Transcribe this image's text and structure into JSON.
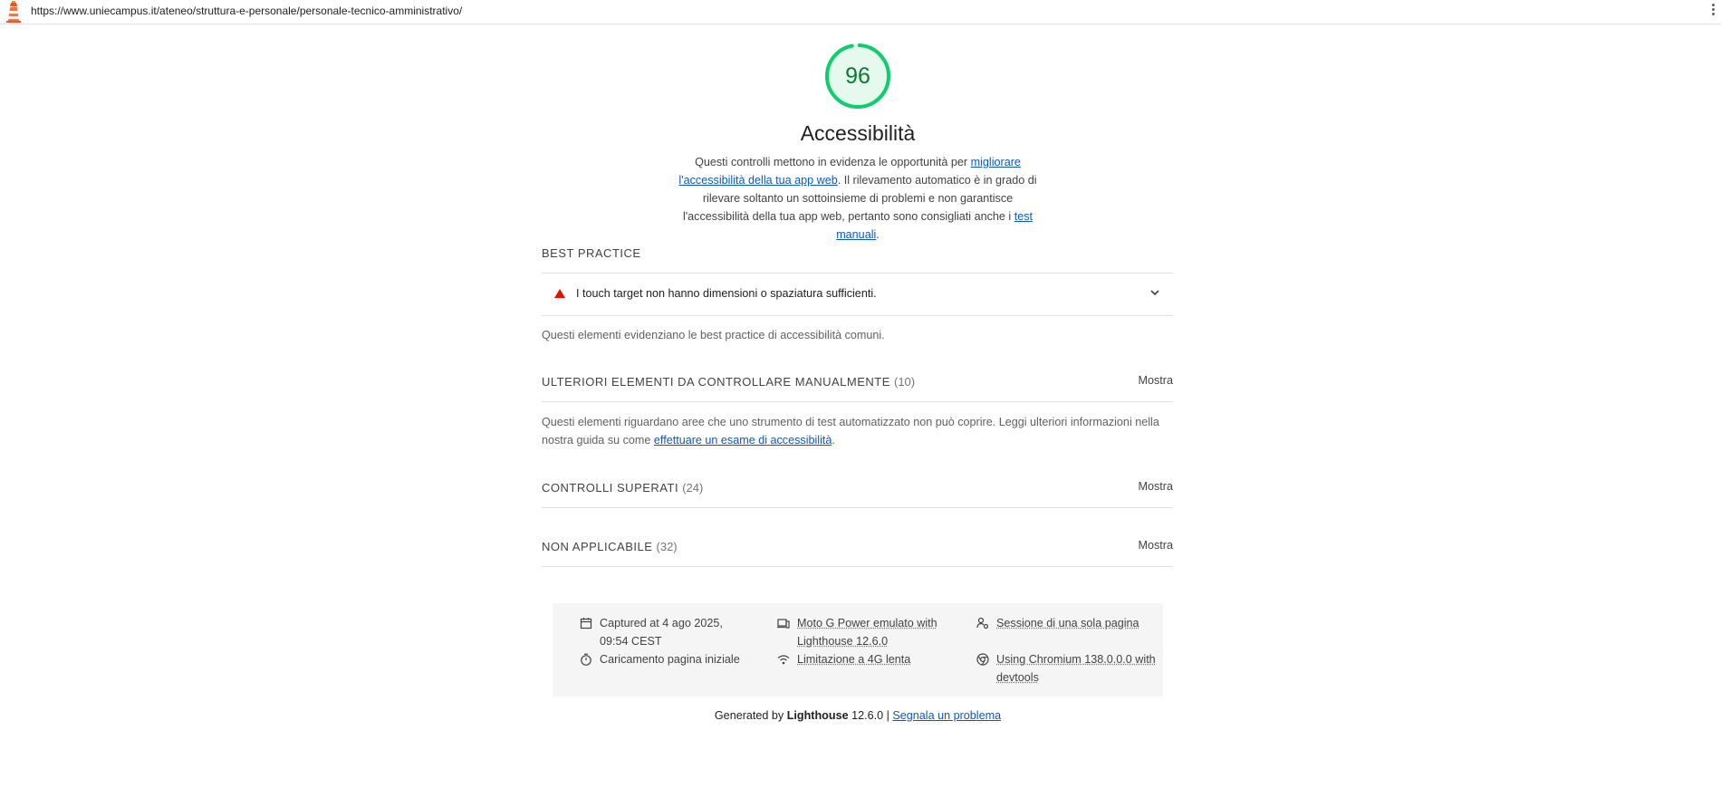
{
  "browser": {
    "url": "https://www.uniecampus.it/ateneo/struttura-e-personale/personale-tecnico-amministrativo/"
  },
  "category": {
    "score": "96",
    "score_fraction": 0.96,
    "title": "Accessibilità",
    "desc_part1": "Questi controlli mettono in evidenza le opportunità per ",
    "desc_link1": "migliorare l'accessibilità della tua app web",
    "desc_part2": ". Il rilevamento automatico è in grado di rilevare soltanto un sottoinsieme di problemi e non garantisce l'accessibilità della tua app web, pertanto sono consigliati anche i ",
    "desc_link2": "test manuali",
    "desc_part3": "."
  },
  "best_practice": {
    "heading": "Best practice",
    "audit_title": "I touch target non hanno dimensioni o spaziatura sufficienti.",
    "description": "Questi elementi evidenziano le best practice di accessibilità comuni."
  },
  "manual": {
    "heading": "Ulteriori elementi da controllare manualmente",
    "count": "(10)",
    "toggle": "Mostra",
    "desc_part1": "Questi elementi riguardano aree che uno strumento di test automatizzato non può coprire. Leggi ulteriori informazioni nella nostra guida su come ",
    "desc_link": "effettuare un esame di accessibilità",
    "desc_part2": "."
  },
  "passed": {
    "heading": "Controlli superati",
    "count": "(24)",
    "toggle": "Mostra"
  },
  "not_applicable": {
    "heading": "Non applicabile",
    "count": "(32)",
    "toggle": "Mostra"
  },
  "environment": {
    "captured": "Captured at 4 ago 2025, 09:54 CEST",
    "load": "Caricamento pagina iniziale",
    "device": "Moto G Power emulato with Lighthouse 12.6.0",
    "throttling": "Limitazione a 4G lenta",
    "session": "Sessione di una sola pagina",
    "browser": "Using Chromium 138.0.0.0 with devtools"
  },
  "footer": {
    "generated_by": "Generated by",
    "product": "Lighthouse",
    "version": "12.6.0 |",
    "report_link": "Segnala un problema"
  },
  "colors": {
    "pass": "#0cce6b",
    "pass_text": "#0c7a2e",
    "fail": "#eb0f00",
    "link": "#0b57d0"
  }
}
